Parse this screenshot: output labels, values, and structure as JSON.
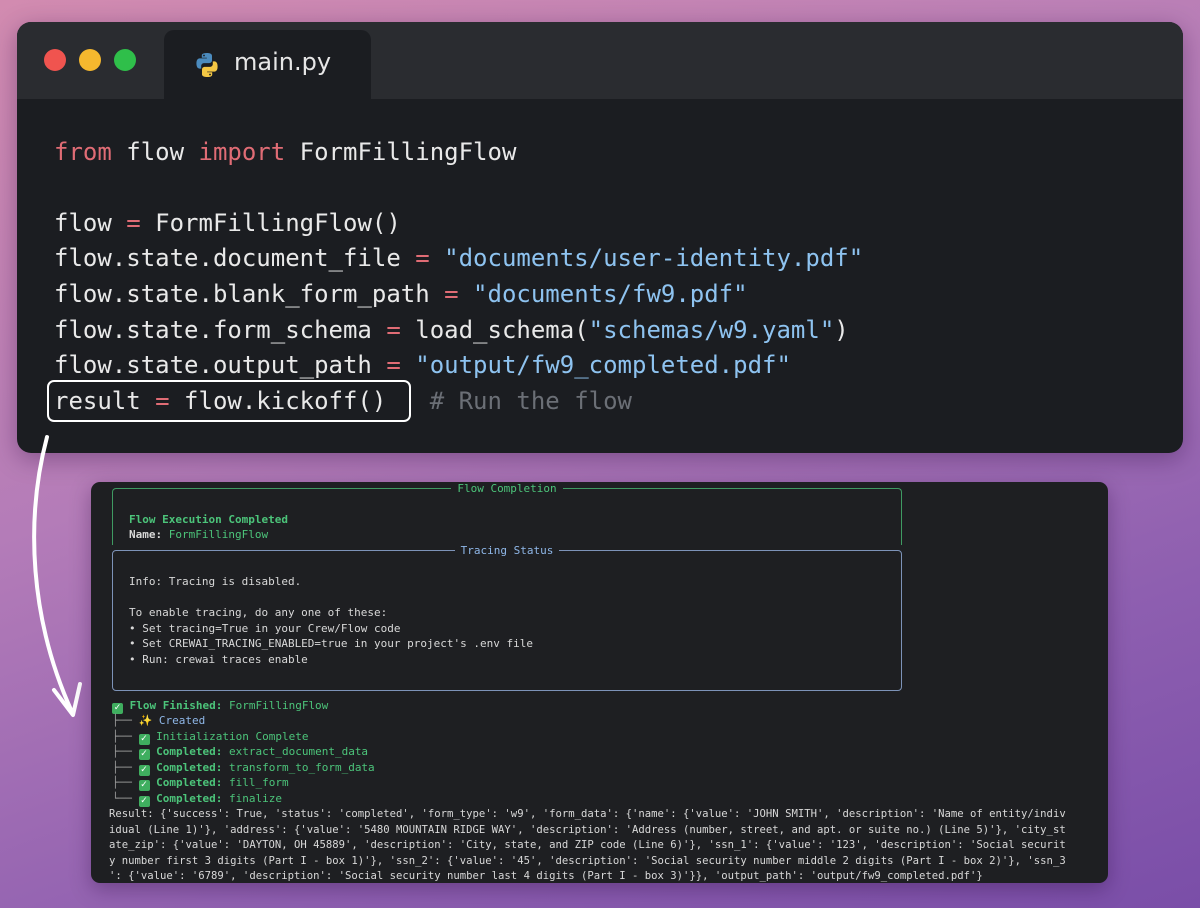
{
  "editor": {
    "tab_label": "main.py",
    "tab_icon": "python-icon",
    "code_lines": [
      [
        {
          "t": "from",
          "c": "kw"
        },
        {
          "t": " flow ",
          "c": ""
        },
        {
          "t": "import",
          "c": "kw"
        },
        {
          "t": " FormFillingFlow",
          "c": ""
        }
      ],
      [],
      [
        {
          "t": "flow ",
          "c": ""
        },
        {
          "t": "=",
          "c": "op"
        },
        {
          "t": " FormFillingFlow()",
          "c": ""
        }
      ],
      [
        {
          "t": "flow.state.document_file ",
          "c": ""
        },
        {
          "t": "=",
          "c": "op"
        },
        {
          "t": " ",
          "c": ""
        },
        {
          "t": "\"documents/user-identity.pdf\"",
          "c": "str"
        }
      ],
      [
        {
          "t": "flow.state.blank_form_path ",
          "c": ""
        },
        {
          "t": "=",
          "c": "op"
        },
        {
          "t": " ",
          "c": ""
        },
        {
          "t": "\"documents/fw9.pdf\"",
          "c": "str"
        }
      ],
      [
        {
          "t": "flow.state.form_schema ",
          "c": ""
        },
        {
          "t": "=",
          "c": "op"
        },
        {
          "t": " load_schema(",
          "c": ""
        },
        {
          "t": "\"schemas/w9.yaml\"",
          "c": "str"
        },
        {
          "t": ")",
          "c": ""
        }
      ],
      [
        {
          "t": "flow.state.output_path ",
          "c": ""
        },
        {
          "t": "=",
          "c": "op"
        },
        {
          "t": " ",
          "c": ""
        },
        {
          "t": "\"output/fw9_completed.pdf\"",
          "c": "str"
        }
      ],
      [
        {
          "t": "result ",
          "c": ""
        },
        {
          "t": "=",
          "c": "op"
        },
        {
          "t": " flow.kickoff()",
          "c": ""
        },
        {
          "t": "   # Run the flow",
          "c": "cmt"
        }
      ]
    ]
  },
  "terminal": {
    "completion_panel_title": "Flow Completion",
    "completion_heading": "Flow Execution Completed",
    "name_label": "Name: ",
    "name_value": "FormFillingFlow",
    "tracing_panel_title": "Tracing Status",
    "tracing_info": "Info: Tracing is disabled.",
    "tracing_intro": "To enable tracing, do any one of these:",
    "tracing_bullets": [
      "• Set tracing=True in your Crew/Flow code",
      "• Set CREWAI_TRACING_ENABLED=true in your project's .env file",
      "• Run: crewai traces enable"
    ],
    "finished_label": "Flow Finished: ",
    "finished_value": "FormFillingFlow",
    "tree": [
      {
        "prefix": "├── ",
        "icon": "sparkle",
        "label": "Created",
        "value": ""
      },
      {
        "prefix": "├── ",
        "icon": "check",
        "label": "Initialization Complete",
        "value": ""
      },
      {
        "prefix": "├── ",
        "icon": "check",
        "label": "Completed: ",
        "value": "extract_document_data"
      },
      {
        "prefix": "├── ",
        "icon": "check",
        "label": "Completed: ",
        "value": "transform_to_form_data"
      },
      {
        "prefix": "├── ",
        "icon": "check",
        "label": "Completed: ",
        "value": "fill_form"
      },
      {
        "prefix": "└── ",
        "icon": "check",
        "label": "Completed: ",
        "value": "finalize"
      }
    ],
    "result_lines": [
      "Result: {'success': True, 'status': 'completed', 'form_type': 'w9', 'form_data': {'name': {'value': 'JOHN SMITH', 'description': 'Name of entity/indiv",
      "idual (Line 1)'}, 'address': {'value': '5480 MOUNTAIN RIDGE WAY', 'description': 'Address (number, street, and apt. or suite no.) (Line 5)'}, 'city_st",
      "ate_zip': {'value': 'DAYTON, OH 45889', 'description': 'City, state, and ZIP code (Line 6)'}, 'ssn_1': {'value': '123', 'description': 'Social securit",
      "y number first 3 digits (Part I - box 1)'}, 'ssn_2': {'value': '45', 'description': 'Social security number middle 2 digits (Part I - box 2)'}, 'ssn_3",
      "': {'value': '6789', 'description': 'Social security number last 4 digits (Part I - box 3)'}}, 'output_path': 'output/fw9_completed.pdf'}"
    ]
  }
}
